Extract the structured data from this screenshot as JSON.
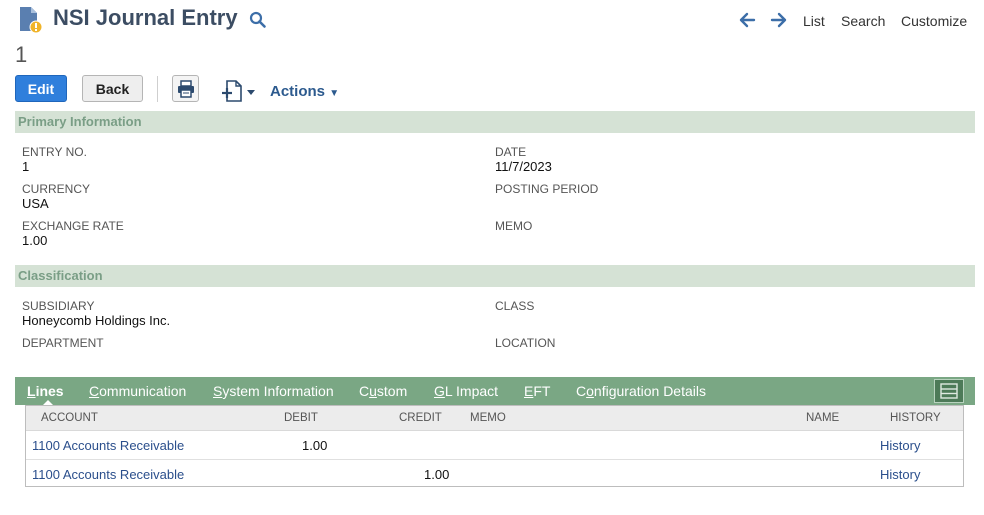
{
  "header": {
    "title": "NSI Journal Entry",
    "record_number": "1",
    "nav": {
      "list": "List",
      "search": "Search",
      "customize": "Customize"
    }
  },
  "toolbar": {
    "edit_label": "Edit",
    "back_label": "Back",
    "actions_label": "Actions"
  },
  "primary": {
    "heading": "Primary Information",
    "entry_no_label": "ENTRY NO.",
    "entry_no": "1",
    "date_label": "DATE",
    "date": "11/7/2023",
    "currency_label": "CURRENCY",
    "currency": "USA",
    "posting_period_label": "POSTING PERIOD",
    "exchange_rate_label": "EXCHANGE RATE",
    "exchange_rate": "1.00",
    "memo_label": "MEMO"
  },
  "classification": {
    "heading": "Classification",
    "subsidiary_label": "SUBSIDIARY",
    "subsidiary": "Honeycomb Holdings Inc.",
    "class_label": "CLASS",
    "department_label": "DEPARTMENT",
    "location_label": "LOCATION"
  },
  "tabs": {
    "lines": {
      "first": "L",
      "rest": "ines"
    },
    "communication": {
      "first": "C",
      "rest": "ommunication"
    },
    "system": {
      "first": "S",
      "rest": "ystem Information"
    },
    "custom": {
      "pre": "C",
      "mid": "u",
      "post": "stom"
    },
    "gl": {
      "first": "G",
      "rest": "L Impact"
    },
    "eft": {
      "first": "E",
      "rest": "FT"
    },
    "config": {
      "pre": "C",
      "mid": "o",
      "post": "nfiguration Details"
    }
  },
  "lines_table": {
    "columns": [
      "ACCOUNT",
      "DEBIT",
      "CREDIT",
      "MEMO",
      "NAME",
      "HISTORY"
    ],
    "rows": [
      {
        "account": "1100 Accounts Receivable",
        "debit": "1.00",
        "credit": "",
        "history": "History"
      },
      {
        "account": "1100 Accounts Receivable",
        "debit": "",
        "credit": "1.00",
        "history": "History"
      }
    ]
  },
  "icons": {
    "record_icon": "document-icon",
    "search_icon": "magnifier-icon",
    "back_arrow": "arrow-left-icon",
    "forward_arrow": "arrow-right-icon",
    "print": "printer-icon",
    "new": "new-document-icon",
    "grid_toggle": "grid-toggle-icon"
  },
  "colors": {
    "primary_button": "#2f7fdc",
    "section_bg": "#d5e2d5",
    "section_text": "#7a9e86",
    "tab_bar": "#7aa784",
    "link": "#2b4f8c"
  }
}
